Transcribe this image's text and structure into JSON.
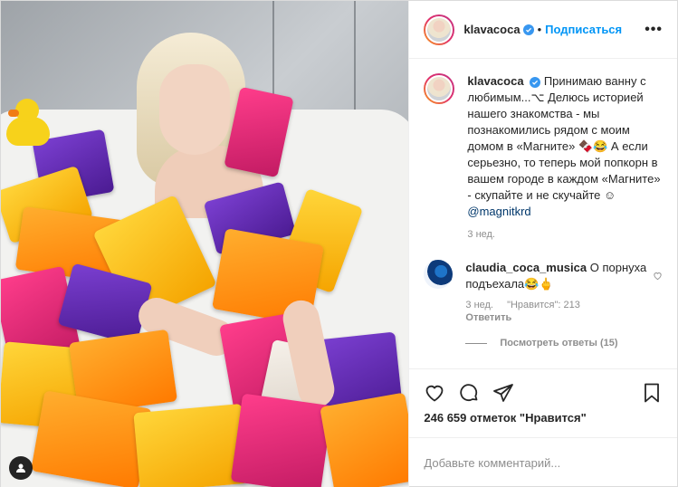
{
  "post": {
    "username": "klavacoca",
    "follow_label": "Подписаться",
    "more_label": "•••"
  },
  "caption": {
    "username": "klavacoca",
    "text": "Принимаю ванну с любимым...⌥ Делюсь историей нашего знакомства - мы познакомились рядом с моим домом в «Магните» 🍫😂 А если серьезно, то теперь мой попкорн в вашем городе в каждом «Магните» - скупайте и не скучайте ☺ ",
    "mention": "@magnitkrd",
    "time": "3 нед."
  },
  "comment": {
    "username": "claudia_coca_musica",
    "text": "О порнуха подъехала😂🖕",
    "time": "3 нед.",
    "likes": "\"Нравится\": 213",
    "reply_label": "Ответить",
    "view_replies": "Посмотреть ответы (15)"
  },
  "likes_label": "246 659 отметок \"Нравится\"",
  "add_comment_placeholder": "Добавьте комментарий...",
  "photo_alt": "Клава Кока в ванне с пакетами попкорна Holy Corn",
  "colors": {
    "accent": "#0095f6",
    "verified": "#3897f0",
    "border": "#dbdbdb"
  }
}
